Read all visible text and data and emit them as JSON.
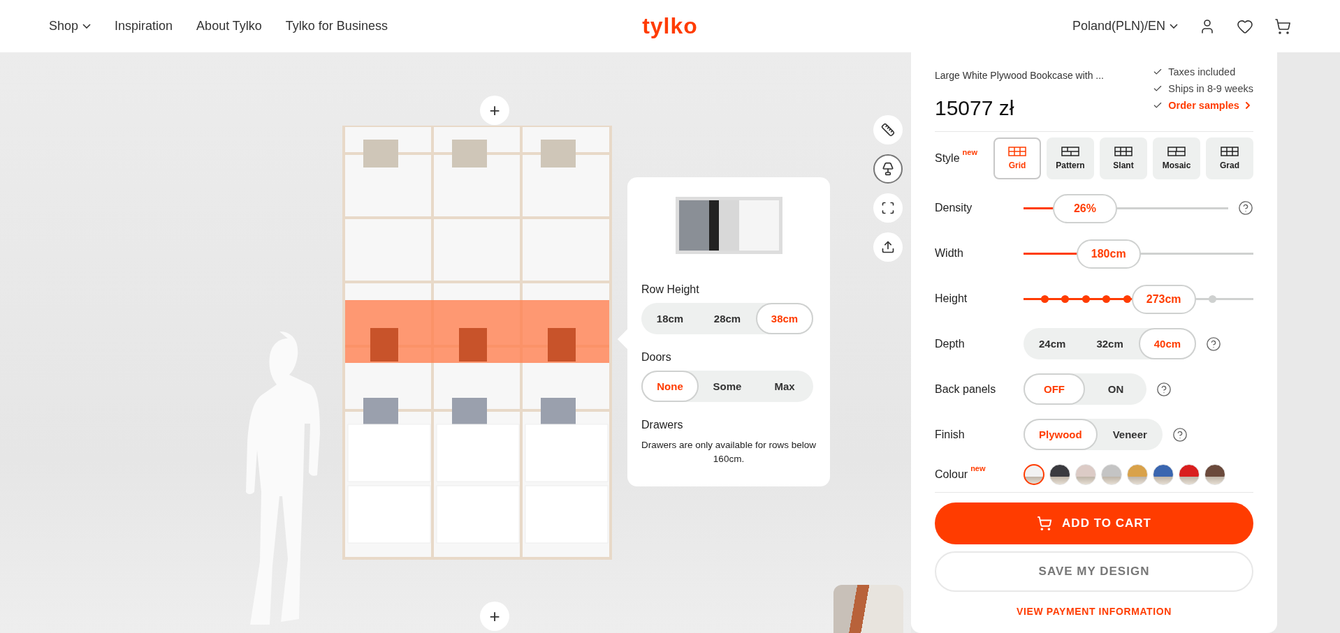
{
  "nav": {
    "links": [
      {
        "label": "Shop",
        "dropdown": true
      },
      {
        "label": "Inspiration",
        "dropdown": false
      },
      {
        "label": "About Tylko",
        "dropdown": false
      },
      {
        "label": "Tylko for Business",
        "dropdown": false
      }
    ],
    "logo": "tylko",
    "region": "Poland(PLN)/EN"
  },
  "canvas": {
    "plus_top": "+",
    "plus_bottom": "+",
    "tools": [
      {
        "kind": "ruler",
        "selected": false
      },
      {
        "kind": "items",
        "selected": true
      },
      {
        "kind": "grid",
        "selected": false
      },
      {
        "kind": "share",
        "selected": false
      }
    ]
  },
  "popover": {
    "row_height": {
      "label": "Row Height",
      "options": [
        {
          "label": "18cm",
          "selected": false
        },
        {
          "label": "28cm",
          "selected": false
        },
        {
          "label": "38cm",
          "selected": true
        }
      ]
    },
    "doors": {
      "label": "Doors",
      "options": [
        {
          "label": "None",
          "selected": true
        },
        {
          "label": "Some",
          "selected": false
        },
        {
          "label": "Max",
          "selected": false
        }
      ]
    },
    "drawers": {
      "label": "Drawers",
      "note": "Drawers are only available for rows below 160cm."
    }
  },
  "product": {
    "title": "Large White Plywood Bookcase with ...",
    "price": "15077 zł",
    "perks": [
      {
        "label": "Taxes included",
        "kind": "text"
      },
      {
        "label": "Ships in 8-9 weeks",
        "kind": "text"
      },
      {
        "label": "Order samples",
        "kind": "link"
      }
    ]
  },
  "options": [
    {
      "kind": "tiles",
      "label": "Style",
      "badge": "new",
      "items": [
        {
          "label": "Grid",
          "selected": true
        },
        {
          "label": "Pattern",
          "selected": false
        },
        {
          "label": "Slant",
          "selected": false
        },
        {
          "label": "Mosaic",
          "selected": false
        },
        {
          "label": "Grad",
          "selected": false
        }
      ]
    },
    {
      "kind": "slider",
      "label": "Density",
      "value": "26%",
      "level": 0.3,
      "help": true
    },
    {
      "kind": "slider",
      "label": "Width",
      "value": "180cm",
      "level": 0.37,
      "help": false
    },
    {
      "kind": "steps",
      "label": "Height",
      "value": "273cm",
      "level": 0.61,
      "help": false
    },
    {
      "kind": "segmented",
      "label": "Depth",
      "help": true,
      "items": [
        {
          "label": "24cm",
          "selected": false
        },
        {
          "label": "32cm",
          "selected": false
        },
        {
          "label": "40cm",
          "selected": true
        }
      ]
    },
    {
      "kind": "segmented",
      "label": "Back panels",
      "help": true,
      "items": [
        {
          "label": "OFF",
          "selected": true
        },
        {
          "label": "ON",
          "selected": false
        }
      ]
    },
    {
      "kind": "segmented",
      "label": "Finish",
      "help": true,
      "items": [
        {
          "label": "Plywood",
          "selected": true
        },
        {
          "label": "Veneer",
          "selected": false
        }
      ]
    },
    {
      "kind": "swatches",
      "label": "Colour",
      "badge": "new",
      "items": [
        {
          "color": "#f2f2f2",
          "selected": true
        },
        {
          "color": "#3a3a3f",
          "selected": false
        },
        {
          "color": "#dccbc6",
          "selected": false
        },
        {
          "color": "#c4c4c4",
          "selected": false
        },
        {
          "color": "#d9a24a",
          "selected": false
        },
        {
          "color": "#3a66b0",
          "selected": false
        },
        {
          "color": "#d91e1e",
          "selected": false
        },
        {
          "color": "#6b4a3c",
          "selected": false
        }
      ]
    }
  ],
  "actions": {
    "add_to_cart": "ADD TO CART",
    "save": "SAVE MY DESIGN",
    "payment": "VIEW PAYMENT INFORMATION"
  }
}
